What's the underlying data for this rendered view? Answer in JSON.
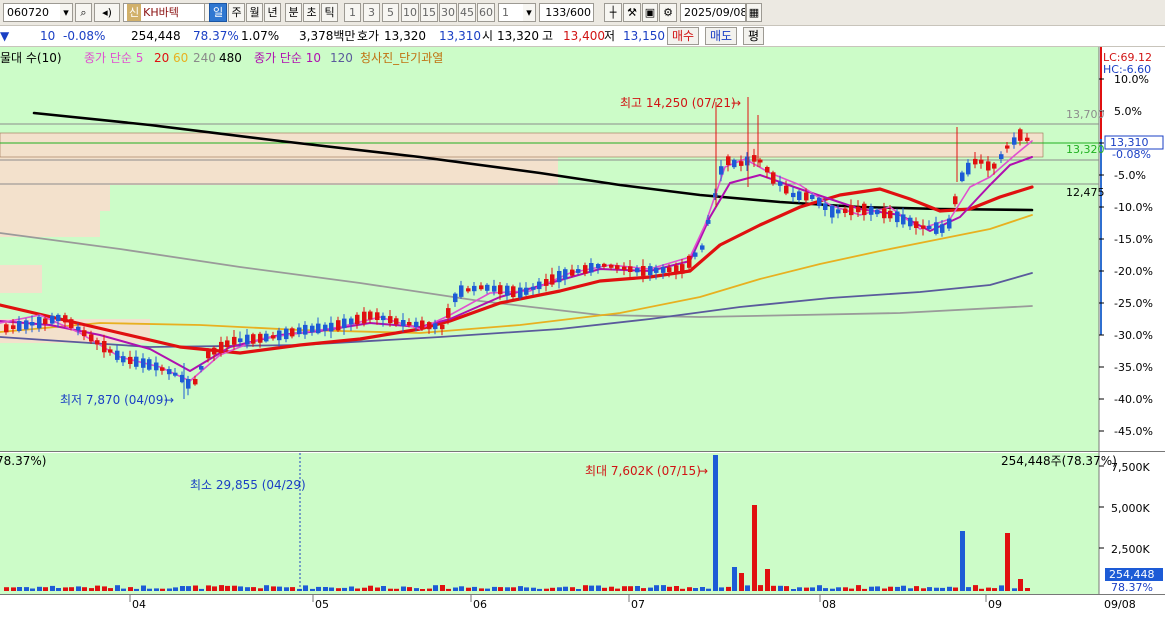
{
  "toolbar": {
    "code": "060720",
    "badge": "신",
    "name": "KH바텍",
    "period_tabs": [
      "일",
      "주",
      "월",
      "년",
      "분",
      "초",
      "틱"
    ],
    "active_period": "일",
    "intervals": [
      "1",
      "3",
      "5",
      "10",
      "15",
      "30",
      "45",
      "60"
    ],
    "interval_value": "1",
    "count": "133/600",
    "date": "2025/09/08"
  },
  "quote": {
    "change": "10",
    "change_pct": "-0.08%",
    "volume": "254,448",
    "volume_ratio": "78.37%",
    "turnover": "1.07%",
    "amount": "3,378백만",
    "bid_label": "호가",
    "bid": "13,320",
    "ask": "13,310",
    "open_label": "시",
    "open": "13,320",
    "high_label": "고",
    "high": "13,400",
    "low_label": "저",
    "low": "13,150",
    "buy_label": "매수",
    "sell_label": "매도",
    "extra_label": "평"
  },
  "legend": {
    "part1": "물대 수(10)",
    "part2": "종가 단순 5",
    "ma5": "5",
    "ma20": "20",
    "ma60": "60",
    "ma240": "240",
    "ma480": "480",
    "part3": "종가 단순 10",
    "ma120": "120",
    "part4": "청사진_단기과열"
  },
  "price_axis": {
    "lc": "LC:69.12",
    "hc": "HC:-6.60",
    "ticks": [
      "10.0%",
      "5.0%",
      "0.0%",
      "-5.0%",
      "-10.0%",
      "-15.0%",
      "-20.0%",
      "-25.0%",
      "-30.0%",
      "-35.0%",
      "-40.0%",
      "-45.0%"
    ],
    "current_price": "13,310",
    "current_pct": "-0.08%",
    "level_13700": "13,700",
    "level_13320": "13,320",
    "level_12475": "12,475"
  },
  "annotations": {
    "high": "최고 14,250 (07/21)",
    "low": "최저 7,870 (04/09)",
    "max_volume": "최대 7,602K (07/15)",
    "min_volume": "최소 29,855 (04/29)",
    "volume_now": "254,448주(78.37%)",
    "volume_left": "78.37%)"
  },
  "volume_axis": {
    "ticks": [
      "7,500K",
      "5,000K",
      "2,500K"
    ],
    "current_volume": "254,448",
    "current_pct": "78.37%"
  },
  "time_axis": {
    "labels": [
      "04",
      "05",
      "06",
      "07",
      "08",
      "09"
    ],
    "end_label": "09/08"
  },
  "colors": {
    "chart_bg": "#ccfcc8",
    "up": "#e01010",
    "down": "#1d5bd6",
    "ma5": "#e050d0",
    "ma10": "#b010b0",
    "ma20": "#e01010",
    "ma60": "#e8b020",
    "ma120": "#5a5a9c",
    "ma240": "#9a9a9a",
    "ma480": "#000000"
  },
  "chart_data": {
    "type": "candlestick",
    "price_range": [
      7200,
      14900
    ],
    "volume_range_k": [
      0,
      8000
    ],
    "period": "2025/03 - 2025/09/08",
    "key_points": [
      {
        "label": "low",
        "date": "04/09",
        "price": 7870
      },
      {
        "label": "high",
        "date": "07/21",
        "price": 14250
      },
      {
        "label": "last",
        "date": "09/08",
        "price": 13310
      }
    ],
    "volume_key_points": [
      {
        "label": "max",
        "date": "07/15",
        "volume": 7602000
      },
      {
        "label": "min",
        "date": "04/29",
        "volume": 29855
      },
      {
        "label": "last",
        "date": "09/08",
        "volume": 254448
      }
    ]
  }
}
